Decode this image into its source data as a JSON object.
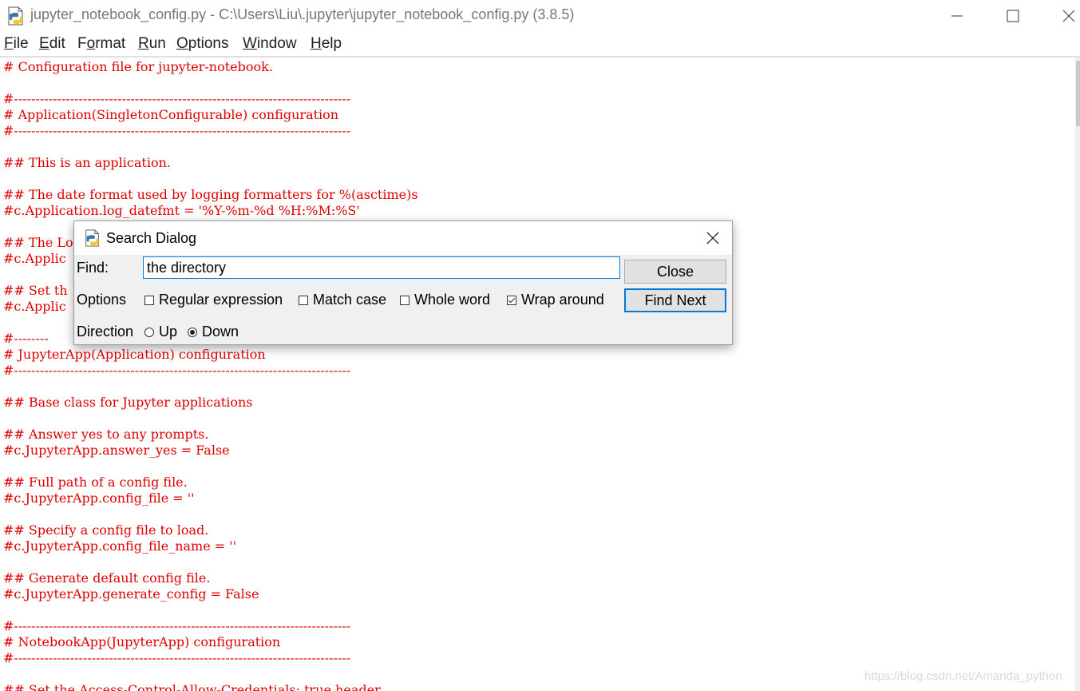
{
  "window": {
    "title": "jupyter_notebook_config.py - C:\\Users\\Liu\\.jupyter\\jupyter_notebook_config.py (3.8.5)"
  },
  "menu": [
    {
      "accel": "F",
      "rest": "ile"
    },
    {
      "accel": "E",
      "rest": "dit"
    },
    {
      "pre": "F",
      "accel": "o",
      "rest": "rmat"
    },
    {
      "accel": "R",
      "rest": "un"
    },
    {
      "accel": "O",
      "rest": "ptions"
    },
    {
      "accel": "W",
      "rest": "indow"
    },
    {
      "accel": "H",
      "rest": "elp"
    }
  ],
  "editor": {
    "lines": [
      "# Configuration file for jupyter-notebook.",
      "",
      "#------------------------------------------------------------------------------",
      "# Application(SingletonConfigurable) configuration",
      "#------------------------------------------------------------------------------",
      "",
      "## This is an application.",
      "",
      "## The date format used by logging formatters for %(asctime)s",
      "#c.Application.log_datefmt = '%Y-%m-%d %H:%M:%S'",
      "",
      "## The Lo",
      "#c.Applic",
      "",
      "## Set th",
      "#c.Applic",
      "",
      "#--------",
      "# JupyterApp(Application) configuration",
      "#------------------------------------------------------------------------------",
      "",
      "## Base class for Jupyter applications",
      "",
      "## Answer yes to any prompts.",
      "#c.JupyterApp.answer_yes = False",
      "",
      "## Full path of a config file.",
      "#c.JupyterApp.config_file = ''",
      "",
      "## Specify a config file to load.",
      "#c.JupyterApp.config_file_name = ''",
      "",
      "## Generate default config file.",
      "#c.JupyterApp.generate_config = False",
      "",
      "#------------------------------------------------------------------------------",
      "# NotebookApp(JupyterApp) configuration",
      "#------------------------------------------------------------------------------",
      "",
      "## Set the Access-Control-Allow-Credentials: true header"
    ]
  },
  "watermark": "https://blog.csdn.net/Amanda_python",
  "dialog": {
    "title": "Search Dialog",
    "find_label": "Find:",
    "find_value": "the directory",
    "close_label": "Close",
    "find_next_label": "Find Next",
    "options_label": "Options",
    "options": [
      {
        "label": "Regular expression",
        "checked": false
      },
      {
        "label": "Match case",
        "checked": false
      },
      {
        "label": "Whole word",
        "checked": false
      },
      {
        "label": "Wrap around",
        "checked": true
      }
    ],
    "direction_label": "Direction",
    "directions": [
      {
        "label": "Up",
        "selected": false
      },
      {
        "label": "Down",
        "selected": true
      }
    ]
  },
  "colors": {
    "comment": "#dd0000",
    "focus_border": "#0078d7"
  }
}
